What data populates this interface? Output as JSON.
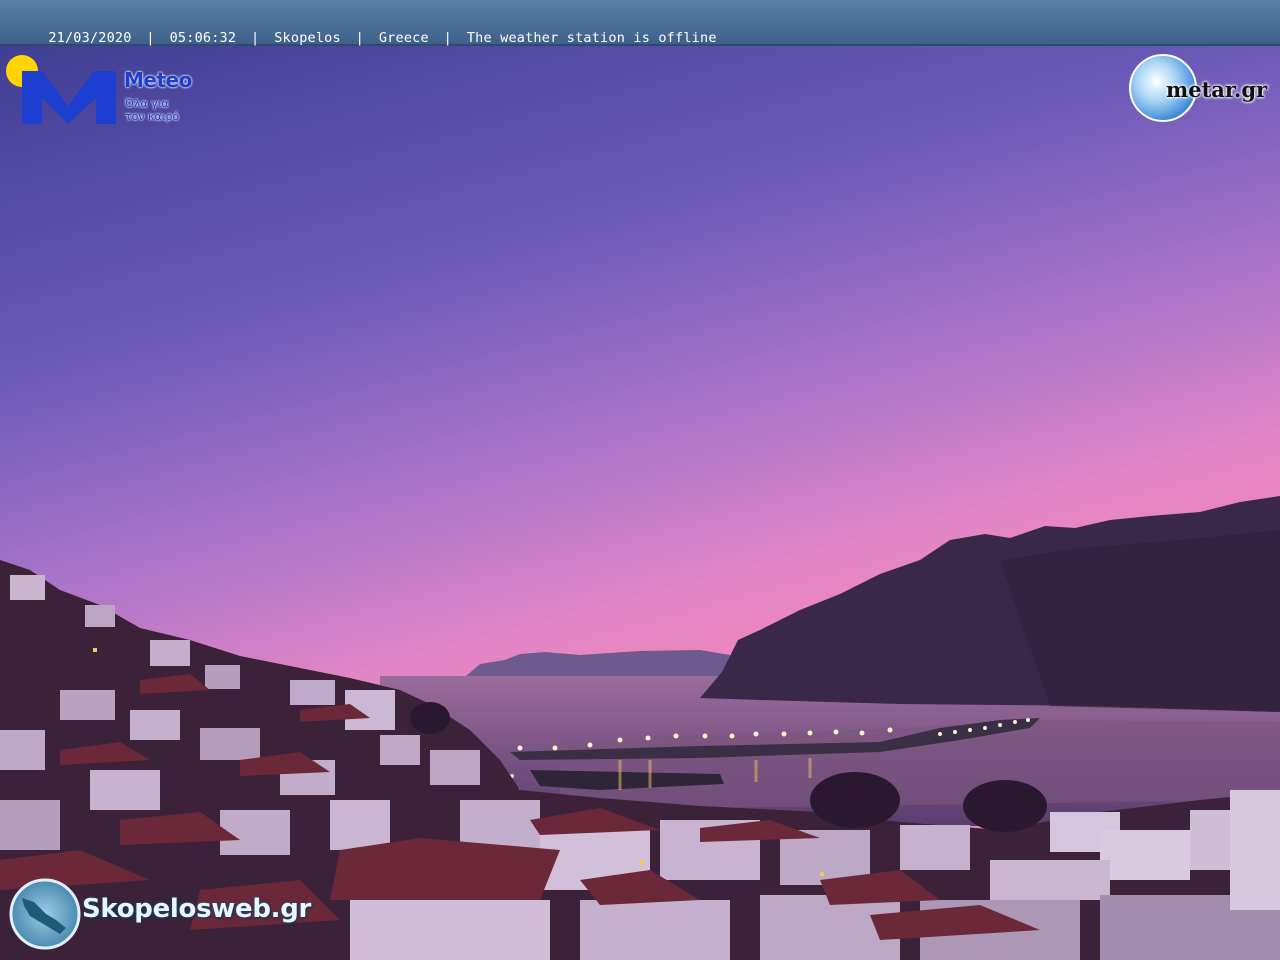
{
  "header": {
    "date": "21/03/2020",
    "time": "05:06:32",
    "location": "Skopelos",
    "country": "Greece",
    "status": "The weather station is offline",
    "separator": "|"
  },
  "logos": {
    "meteo": {
      "name": "Meteo",
      "tagline_line1": "Όλα για",
      "tagline_line2": "τον καιρό"
    },
    "metar": {
      "name": "metar.gr"
    },
    "skopelosweb": {
      "name": "Skopelosweb.gr"
    }
  },
  "colors": {
    "sky_top": "#3f3d93",
    "sky_mid": "#a874c9",
    "sky_horizon": "#f585b3",
    "header_bar": "#4a6d96",
    "meteo_blue": "#1c3fd0",
    "sun_yellow": "#ffd400"
  }
}
